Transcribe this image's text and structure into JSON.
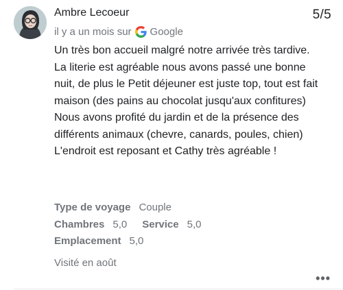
{
  "review": {
    "author": "Ambre Lecoeur",
    "score": "5/5",
    "time": "il y a un mois sur",
    "source": "Google",
    "text": [
      "Un très bon accueil malgré notre arrivée très tardive.",
      "La literie est agréable nous avons passé une bonne nuit, de plus le Petit déjeuner est juste top, tout est fait maison (des pains au chocolat jusqu'aux confitures)",
      "Nous avons profité du jardin et de la présence des différents animaux (chevre, canards, poules, chien) L'endroit est reposant et Cathy très agréable !"
    ],
    "details": {
      "trip_type_label": "Type de voyage",
      "trip_type_value": "Couple",
      "rooms_label": "Chambres",
      "rooms_value": "5,0",
      "service_label": "Service",
      "service_value": "5,0",
      "location_label": "Emplacement",
      "location_value": "5,0"
    },
    "visited": "Visité en août",
    "more_label": "•••"
  },
  "icons": {
    "google": "google-g-icon",
    "more": "more-horizontal-icon"
  },
  "colors": {
    "text": "#202124",
    "secondary": "#70757a",
    "google_blue": "#4285F4",
    "google_red": "#EA4335",
    "google_yellow": "#FBBC05",
    "google_green": "#34A853"
  }
}
